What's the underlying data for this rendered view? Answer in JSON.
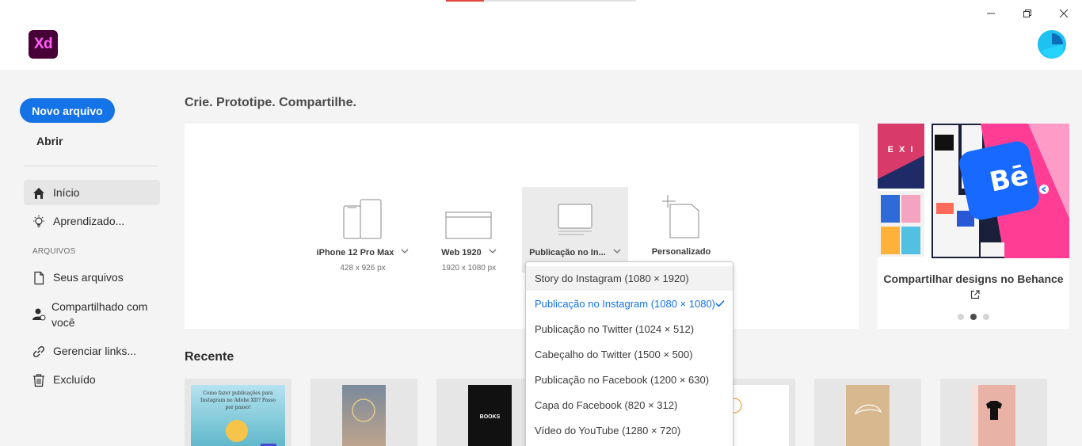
{
  "app": {
    "logo_text": "Xd"
  },
  "window_controls": [
    "minimize-icon",
    "restore-icon",
    "close-icon"
  ],
  "colors": {
    "accent": "#1473e6",
    "logo_bg": "#470137",
    "logo_fg": "#ff61f6",
    "behance_blue": "#1769ff"
  },
  "top_progress_fraction": 0.2,
  "sidebar": {
    "new_file": "Novo arquivo",
    "open": "Abrir",
    "nav": [
      {
        "label": "Início",
        "icon": "home-icon",
        "active": true
      },
      {
        "label": "Aprendizado...",
        "icon": "lightbulb-icon"
      }
    ],
    "section_files": "ARQUIVOS",
    "files": [
      {
        "label": "Seus arquivos",
        "icon": "document-icon"
      },
      {
        "label": "Compartilhado com você",
        "icon": "shared-user-icon"
      },
      {
        "label": "Gerenciar links...",
        "icon": "link-icon"
      },
      {
        "label": "Excluído",
        "icon": "trash-icon"
      }
    ]
  },
  "main": {
    "headline": "Crie. Prototipe. Compartilhe.",
    "presets": [
      {
        "name": "iPhone 12 Pro Max",
        "size": "428 x 926 px"
      },
      {
        "name": "Web 1920",
        "size": "1920 x 1080 px"
      },
      {
        "name": "Publicação no In...",
        "size": ""
      },
      {
        "name": "Personalizado",
        "size": ""
      }
    ],
    "promo": {
      "title": "Compartilhar designs no Behance",
      "slide_index": 1,
      "slide_count": 3,
      "logo_text": "Bē",
      "thumb_text": "E X I"
    },
    "recent_title": "Recente",
    "recent_cards": [
      {
        "text_top": "Como fazer publicações para Instagram no Adobe XD? Passo por passo!"
      },
      {
        "text_top": ""
      },
      {
        "text_top": "BOOKS"
      },
      {
        "text_top": ""
      },
      {
        "text_top": ""
      },
      {
        "text_top": ""
      },
      {
        "text_top": ""
      }
    ]
  },
  "dropdown": {
    "items": [
      {
        "label": "Story do Instagram (1080 × 1920)",
        "state": "hover"
      },
      {
        "label": "Publicação no Instagram (1080 × 1080)",
        "state": "selected"
      },
      {
        "label": "Publicação no Twitter (1024 × 512)",
        "state": ""
      },
      {
        "label": "Cabeçalho do Twitter (1500 × 500)",
        "state": ""
      },
      {
        "label": "Publicação no Facebook (1200 × 630)",
        "state": ""
      },
      {
        "label": "Capa do Facebook (820 × 312)",
        "state": ""
      },
      {
        "label": "Vídeo do YouTube (1280 × 720)",
        "state": ""
      }
    ]
  }
}
